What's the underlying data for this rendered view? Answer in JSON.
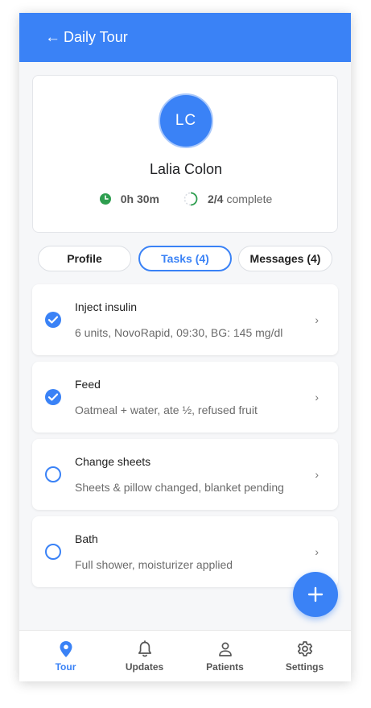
{
  "header": {
    "back_icon": "arrow-left-icon",
    "back_glyph": "←",
    "title": "Daily Tour"
  },
  "patient": {
    "initials": "LC",
    "name": "Lalia Colon",
    "duration": "0h 30m",
    "progress_count": "2/4",
    "progress_label": "complete",
    "progress_fraction": 0.5
  },
  "tabs": [
    {
      "label": "Profile",
      "active": false
    },
    {
      "label": "Tasks (4)",
      "active": true
    },
    {
      "label": "Messages (4)",
      "active": false
    }
  ],
  "tasks": [
    {
      "name": "Inject insulin",
      "detail": "6 units, NovoRapid, 09:30, BG: 145 mg/dl",
      "done": true
    },
    {
      "name": "Feed",
      "detail": "Oatmeal + water, ate ½, refused fruit",
      "done": true
    },
    {
      "name": "Change sheets",
      "detail": "Sheets & pillow changed, blanket pending",
      "done": false
    },
    {
      "name": "Bath",
      "detail": "Full shower, moisturizer applied",
      "done": false
    }
  ],
  "chevron_glyph": "›",
  "fab": {
    "icon": "plus-icon"
  },
  "nav": [
    {
      "label": "Tour",
      "icon": "location-pin-icon",
      "active": true
    },
    {
      "label": "Updates",
      "icon": "bell-icon",
      "active": false
    },
    {
      "label": "Patients",
      "icon": "person-icon",
      "active": false
    },
    {
      "label": "Settings",
      "icon": "gear-icon",
      "active": false
    }
  ],
  "colors": {
    "primary": "#3a82f6",
    "clock_green": "#2e9e4f",
    "background": "#f6f7f9"
  }
}
